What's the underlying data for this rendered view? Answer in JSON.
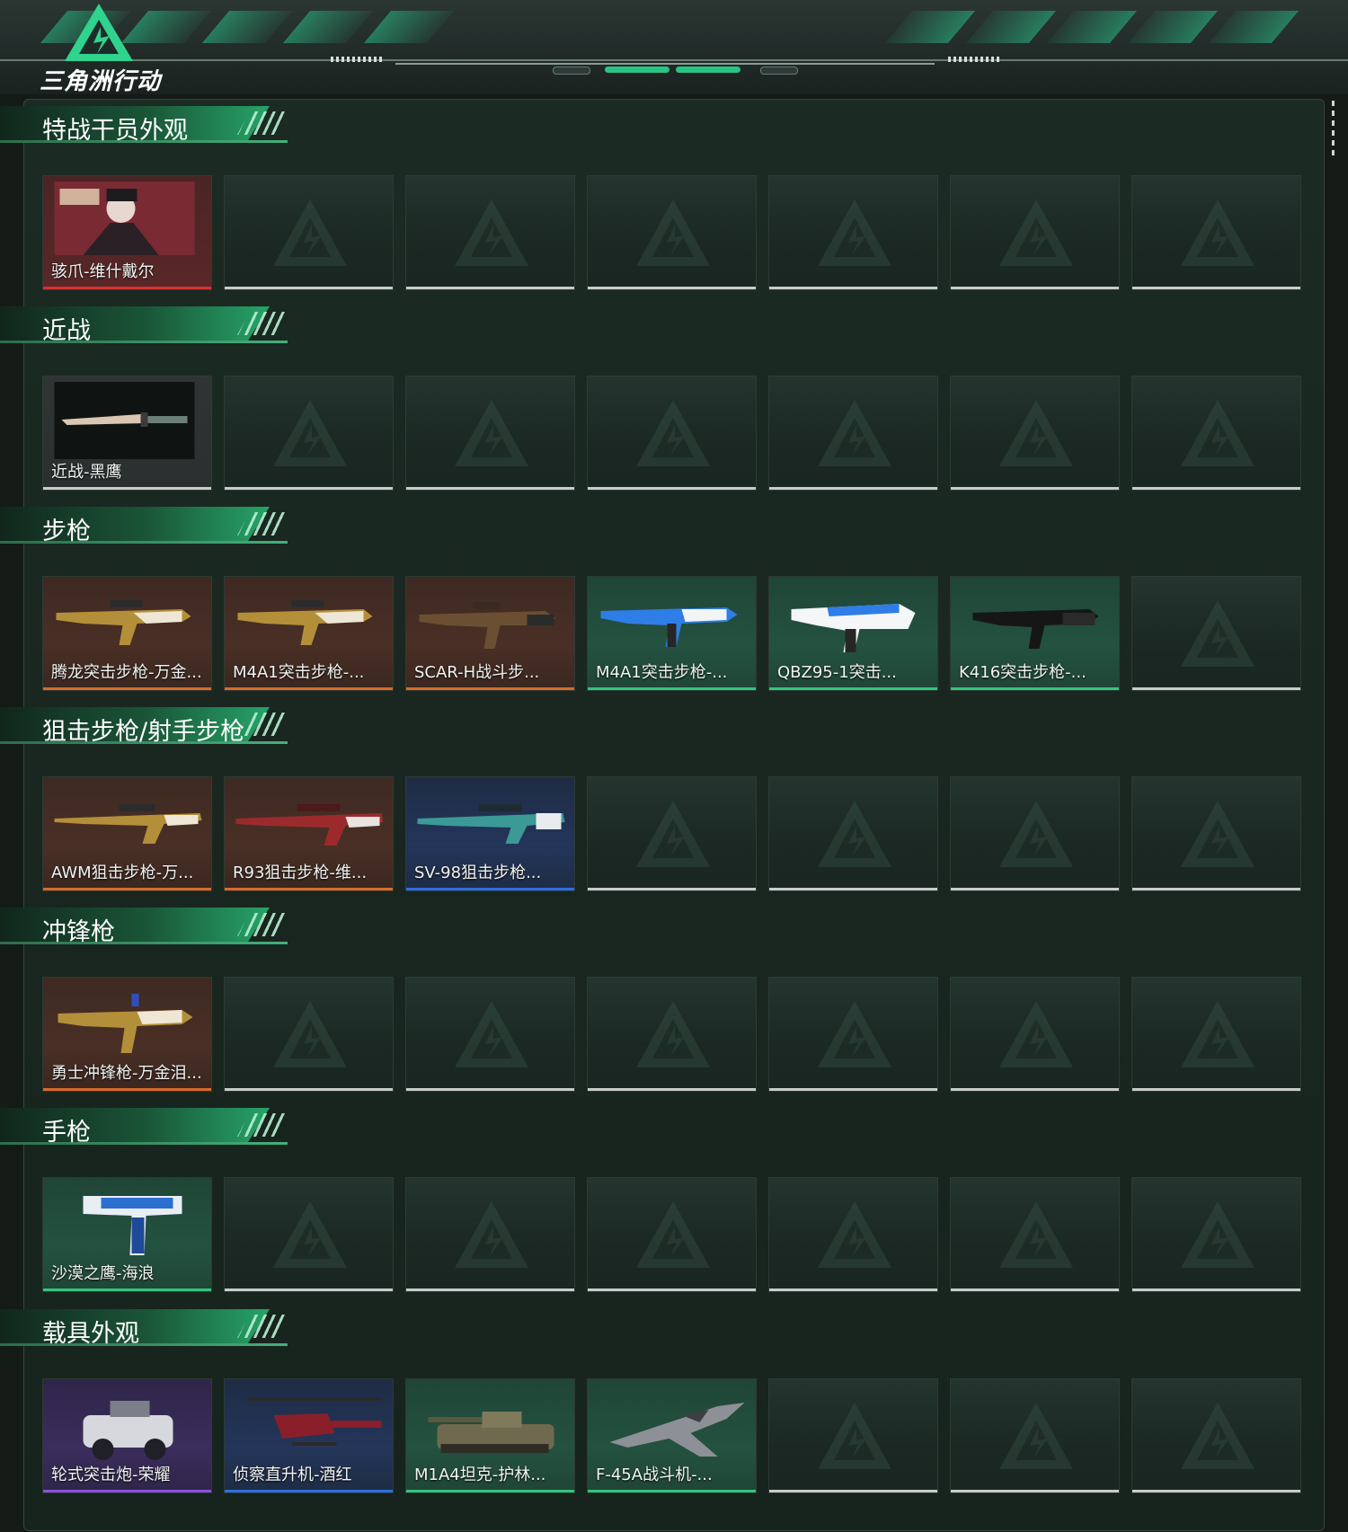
{
  "header": {
    "brand": "三角洲行动"
  },
  "colors": {
    "accent": "#26a468",
    "rarity_red": "#d6312f",
    "rarity_orange": "#d86a2a",
    "rarity_green": "#33c47d",
    "rarity_blue": "#2c6fe0",
    "rarity_purple": "#8a4fe0",
    "rarity_grey": "#c7ccca"
  },
  "sections": [
    {
      "title": "特战干员外观",
      "items": [
        {
          "label": "骇爪-维什戴尔",
          "rarity": "red",
          "art": "operator"
        }
      ]
    },
    {
      "title": "近战",
      "items": [
        {
          "label": "近战-黑鹰",
          "rarity": "grey",
          "art": "knife"
        }
      ]
    },
    {
      "title": "步枪",
      "items": [
        {
          "label": "腾龙突击步枪-万金...",
          "rarity": "orange",
          "art": "rifle-gold"
        },
        {
          "label": "M4A1突击步枪-...",
          "rarity": "orange",
          "art": "rifle-gold"
        },
        {
          "label": "SCAR-H战斗步...",
          "rarity": "orange",
          "art": "rifle-brown"
        },
        {
          "label": "M4A1突击步枪-...",
          "rarity": "green",
          "art": "rifle-blue"
        },
        {
          "label": "QBZ95-1突击...",
          "rarity": "green",
          "art": "rifle-white"
        },
        {
          "label": "K416突击步枪-...",
          "rarity": "green",
          "art": "rifle-black"
        }
      ]
    },
    {
      "title": "狙击步枪/射手步枪",
      "items": [
        {
          "label": "AWM狙击步枪-万...",
          "rarity": "orange",
          "art": "sniper-gold"
        },
        {
          "label": "R93狙击步枪-维...",
          "rarity": "orange",
          "art": "sniper-red"
        },
        {
          "label": "SV-98狙击步枪...",
          "rarity": "blue",
          "art": "sniper-teal"
        }
      ]
    },
    {
      "title": "冲锋枪",
      "items": [
        {
          "label": "勇士冲锋枪-万金泪...",
          "rarity": "orange",
          "art": "smg-gold"
        }
      ]
    },
    {
      "title": "手枪",
      "items": [
        {
          "label": "沙漠之鹰-海浪",
          "rarity": "green",
          "art": "pistol"
        }
      ]
    },
    {
      "title": "载具外观",
      "items": [
        {
          "label": "轮式突击炮-荣耀",
          "rarity": "purple",
          "art": "vehicle"
        },
        {
          "label": "侦察直升机-酒红",
          "rarity": "blue",
          "art": "helicopter"
        },
        {
          "label": "M1A4坦克-护林...",
          "rarity": "green",
          "art": "tank"
        },
        {
          "label": "F-45A战斗机-...",
          "rarity": "green",
          "art": "jet"
        }
      ]
    }
  ],
  "slots_per_row": 7
}
